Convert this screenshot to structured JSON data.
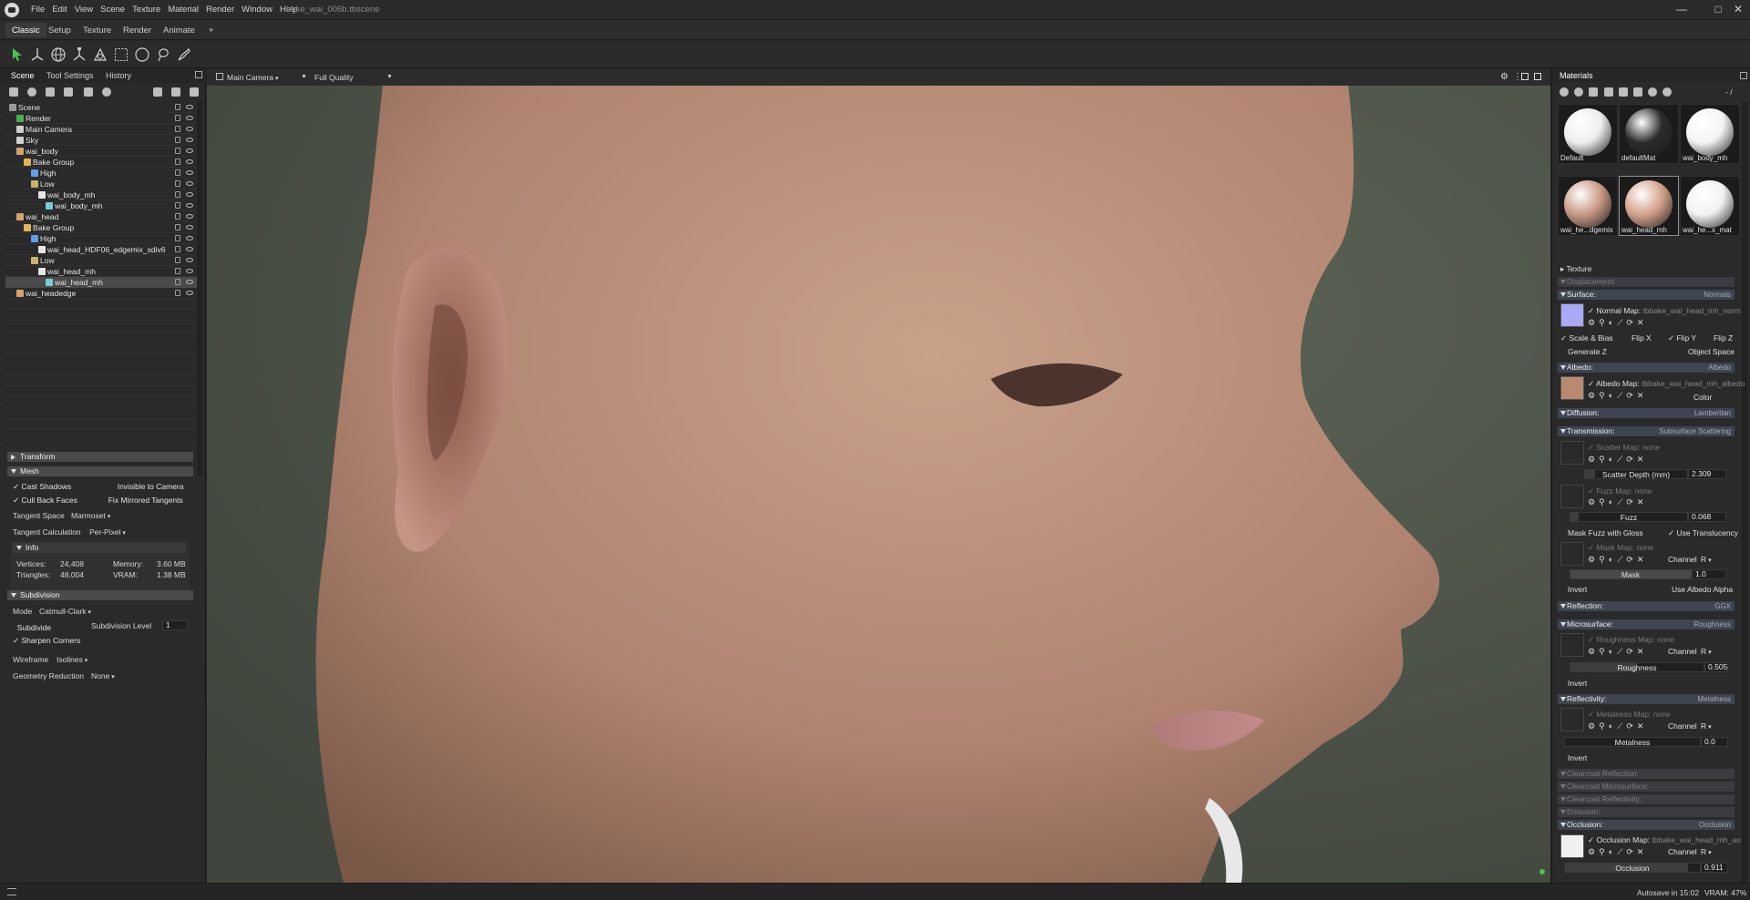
{
  "app": {
    "document_title": "bake_wai_006b.tbscene",
    "menu": [
      "File",
      "Edit",
      "View",
      "Scene",
      "Texture",
      "Material",
      "Render",
      "Window",
      "Help"
    ],
    "window_controls": [
      "—",
      "□",
      "✕"
    ]
  },
  "tabs": {
    "items": [
      "Classic",
      "Setup",
      "Texture",
      "Render",
      "Animate"
    ],
    "add": "+"
  },
  "left_panel": {
    "tabs": [
      "Scene",
      "Tool Settings",
      "History"
    ],
    "tree": [
      {
        "label": "Scene",
        "indent": 0,
        "icon": "scene"
      },
      {
        "label": "Render",
        "indent": 1,
        "icon": "render"
      },
      {
        "label": "Main Camera",
        "indent": 1,
        "icon": "camera"
      },
      {
        "label": "Sky",
        "indent": 1,
        "icon": "sky"
      },
      {
        "label": "wai_body",
        "indent": 1,
        "icon": "object"
      },
      {
        "label": "Bake Group",
        "indent": 2,
        "icon": "folder"
      },
      {
        "label": "High",
        "indent": 3,
        "icon": "high"
      },
      {
        "label": "Low",
        "indent": 3,
        "icon": "low"
      },
      {
        "label": "wai_body_mh",
        "indent": 4,
        "icon": "mesh"
      },
      {
        "label": "wai_body_mh",
        "indent": 5,
        "icon": "mesh2"
      },
      {
        "label": "wai_head",
        "indent": 1,
        "icon": "object"
      },
      {
        "label": "Bake Group",
        "indent": 2,
        "icon": "folder"
      },
      {
        "label": "High",
        "indent": 3,
        "icon": "high"
      },
      {
        "label": "wai_head_HDF06_edgemix_sdiv6",
        "indent": 4,
        "icon": "mesh"
      },
      {
        "label": "Low",
        "indent": 3,
        "icon": "low"
      },
      {
        "label": "wai_head_mh",
        "indent": 4,
        "icon": "mesh"
      },
      {
        "label": "wai_head_mh",
        "indent": 5,
        "icon": "mesh2",
        "selected": true
      },
      {
        "label": "wai_headedge",
        "indent": 1,
        "icon": "object"
      }
    ],
    "transform_header": "Transform",
    "mesh_header": "Mesh",
    "mesh": {
      "cast_shadows": "Cast Shadows",
      "invisible_to_camera": "Invisible to Camera",
      "cull_back_faces": "Cull Back Faces",
      "fix_mirrored_tangents": "Fix Mirrored Tangents",
      "tangent_space_label": "Tangent Space",
      "tangent_space_value": "Marmoset",
      "tangent_calc_label": "Tangent Calculation",
      "tangent_calc_value": "Per-Pixel"
    },
    "info": {
      "header": "Info",
      "vertices_label": "Vertices:",
      "vertices_value": "24,408",
      "triangles_label": "Triangles:",
      "triangles_value": "48,004",
      "memory_label": "Memory:",
      "memory_value": "3.60 MB",
      "vram_label": "VRAM:",
      "vram_value": "1.38 MB"
    },
    "subdivision": {
      "header": "Subdivision",
      "mode_label": "Mode",
      "mode_value": "Catmull-Clark",
      "subdivide": "Subdivide",
      "level_label": "Subdivision Level",
      "level_value": "1",
      "sharpen_corners": "Sharpen Corners",
      "wireframe_label": "Wireframe",
      "wireframe_value": "Isolines",
      "geo_reduction_label": "Geometry Reduction",
      "geo_reduction_value": "None"
    }
  },
  "viewport": {
    "camera": "Main Camera",
    "quality": "Full Quality",
    "colors": {
      "background": "#525a4e",
      "skin": "#c49a85"
    }
  },
  "right_panel": {
    "title": "Materials",
    "counter": "- /",
    "materials": [
      {
        "name": "Default",
        "color": "#eeeeee"
      },
      {
        "name": "defaultMat",
        "color": "#2c2c2c"
      },
      {
        "name": "wai_body_mh",
        "color": "#f4f4f4"
      },
      {
        "name": "wai_he...dgemix",
        "color": "#c99a85"
      },
      {
        "name": "wai_head_mh",
        "color": "#d4a38b",
        "selected": true
      },
      {
        "name": "wai_he...x_mat",
        "color": "#f2f2f2"
      }
    ],
    "texture_label": "Texture",
    "displacement": "Displacement:",
    "surface": {
      "label": "Surface:",
      "value": "Normals"
    },
    "normal_map": {
      "label": "Normal Map:",
      "file": "tbbake_wai_head_mh_norm"
    },
    "normal_opts": {
      "scale_bias": "Scale & Bias",
      "flip_x": "Flip X",
      "flip_y": "Flip Y",
      "flip_z": "Flip Z",
      "generate_z": "Generate Z",
      "object_space": "Object Space"
    },
    "albedo": {
      "label": "Albedo:",
      "value": "Albedo"
    },
    "albedo_map": {
      "label": "Albedo Map:",
      "file": "tbbake_wai_head_mh_albedo",
      "color_label": "Color"
    },
    "diffusion": {
      "label": "Diffusion:",
      "value": "Lambertian"
    },
    "transmission": {
      "label": "Transmission:",
      "value": "Subsurface Scattering"
    },
    "scatter_map": {
      "label": "Scatter Map:",
      "file": "none"
    },
    "scatter_depth": {
      "label": "Scatter Depth (mm)",
      "value": "2.309"
    },
    "fuzz_map": {
      "label": "Fuzz Map:",
      "file": "none"
    },
    "fuzz": {
      "label": "Fuzz",
      "value": "0.068"
    },
    "mask_fuzz": "Mask Fuzz with Gloss",
    "use_translucency": "Use Translucency",
    "mask_map": {
      "label": "Mask Map:",
      "file": "none",
      "channel_label": "Channel",
      "channel": "R"
    },
    "mask": {
      "label": "Mask",
      "value": "1.0"
    },
    "invert": "Invert",
    "use_albedo_alpha": "Use Albedo Alpha",
    "reflection": {
      "label": "Reflection:",
      "value": "GGX"
    },
    "microsurface": {
      "label": "Microsurface:",
      "value": "Roughness"
    },
    "roughness_map": {
      "label": "Roughness Map:",
      "file": "none",
      "channel_label": "Channel",
      "channel": "R"
    },
    "roughness": {
      "label": "Roughness",
      "value": "0.505"
    },
    "reflectivity": {
      "label": "Reflectivity:",
      "value": "Metalness"
    },
    "metalness_map": {
      "label": "Metalness Map:",
      "file": "none",
      "channel_label": "Channel",
      "channel": "R"
    },
    "metalness": {
      "label": "Metalness",
      "value": "0.0"
    },
    "clearcoat_reflection": "Clearcoat Reflection:",
    "clearcoat_microsurface": "Clearcoat Microsurface:",
    "clearcoat_reflectivity": "Clearcoat Reflectivity:",
    "emission": "Emission:",
    "occlusion": {
      "label": "Occlusion:",
      "value": "Occlusion"
    },
    "occlusion_map": {
      "label": "Occlusion Map:",
      "file": "tbbake_wai_head_mh_ao",
      "channel_label": "Channel",
      "channel": "R"
    },
    "occlusion_value": {
      "label": "Occlusion",
      "value": "0.911"
    }
  },
  "status": {
    "autosave": "Autosave in 15:02",
    "vram": "VRAM: 47%"
  }
}
